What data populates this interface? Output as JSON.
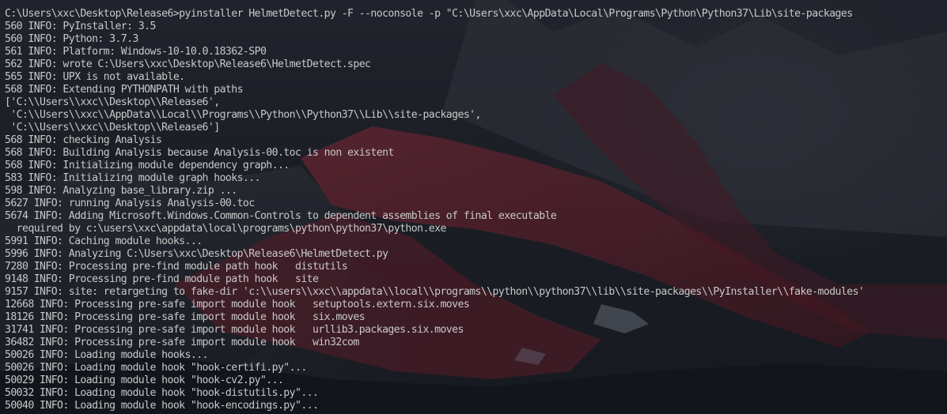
{
  "terminal": {
    "lines": [
      "C:\\Users\\xxc\\Desktop\\Release6>pyinstaller HelmetDetect.py -F --noconsole -p \"C:\\Users\\xxc\\AppData\\Local\\Programs\\Python\\Python37\\Lib\\site-packages",
      "560 INFO: PyInstaller: 3.5",
      "560 INFO: Python: 3.7.3",
      "561 INFO: Platform: Windows-10-10.0.18362-SP0",
      "562 INFO: wrote C:\\Users\\xxc\\Desktop\\Release6\\HelmetDetect.spec",
      "565 INFO: UPX is not available.",
      "568 INFO: Extending PYTHONPATH with paths",
      "['C:\\\\Users\\\\xxc\\\\Desktop\\\\Release6',",
      " 'C:\\\\Users\\\\xxc\\\\AppData\\\\Local\\\\Programs\\\\Python\\\\Python37\\\\Lib\\\\site-packages',",
      " 'C:\\\\Users\\\\xxc\\\\Desktop\\\\Release6']",
      "568 INFO: checking Analysis",
      "568 INFO: Building Analysis because Analysis-00.toc is non existent",
      "568 INFO: Initializing module dependency graph...",
      "583 INFO: Initializing module graph hooks...",
      "598 INFO: Analyzing base_library.zip ...",
      "5627 INFO: running Analysis Analysis-00.toc",
      "5674 INFO: Adding Microsoft.Windows.Common-Controls to dependent assemblies of final executable",
      "  required by c:\\users\\xxc\\appdata\\local\\programs\\python\\python37\\python.exe",
      "5991 INFO: Caching module hooks...",
      "5996 INFO: Analyzing C:\\Users\\xxc\\Desktop\\Release6\\HelmetDetect.py",
      "7280 INFO: Processing pre-find module path hook   distutils",
      "9148 INFO: Processing pre-find module path hook   site",
      "9157 INFO: site: retargeting to fake-dir 'c:\\\\users\\\\xxc\\\\appdata\\\\local\\\\programs\\\\python\\\\python37\\\\lib\\\\site-packages\\\\PyInstaller\\\\fake-modules'",
      "12668 INFO: Processing pre-safe import module hook   setuptools.extern.six.moves",
      "18126 INFO: Processing pre-safe import module hook   six.moves",
      "31741 INFO: Processing pre-safe import module hook   urllib3.packages.six.moves",
      "36482 INFO: Processing pre-safe import module hook   win32com",
      "50026 INFO: Loading module hooks...",
      "50026 INFO: Loading module hook \"hook-certifi.py\"...",
      "50029 INFO: Loading module hook \"hook-cv2.py\"...",
      "50032 INFO: Loading module hook \"hook-distutils.py\"...",
      "50040 INFO: Loading module hook \"hook-encodings.py\"..."
    ]
  }
}
